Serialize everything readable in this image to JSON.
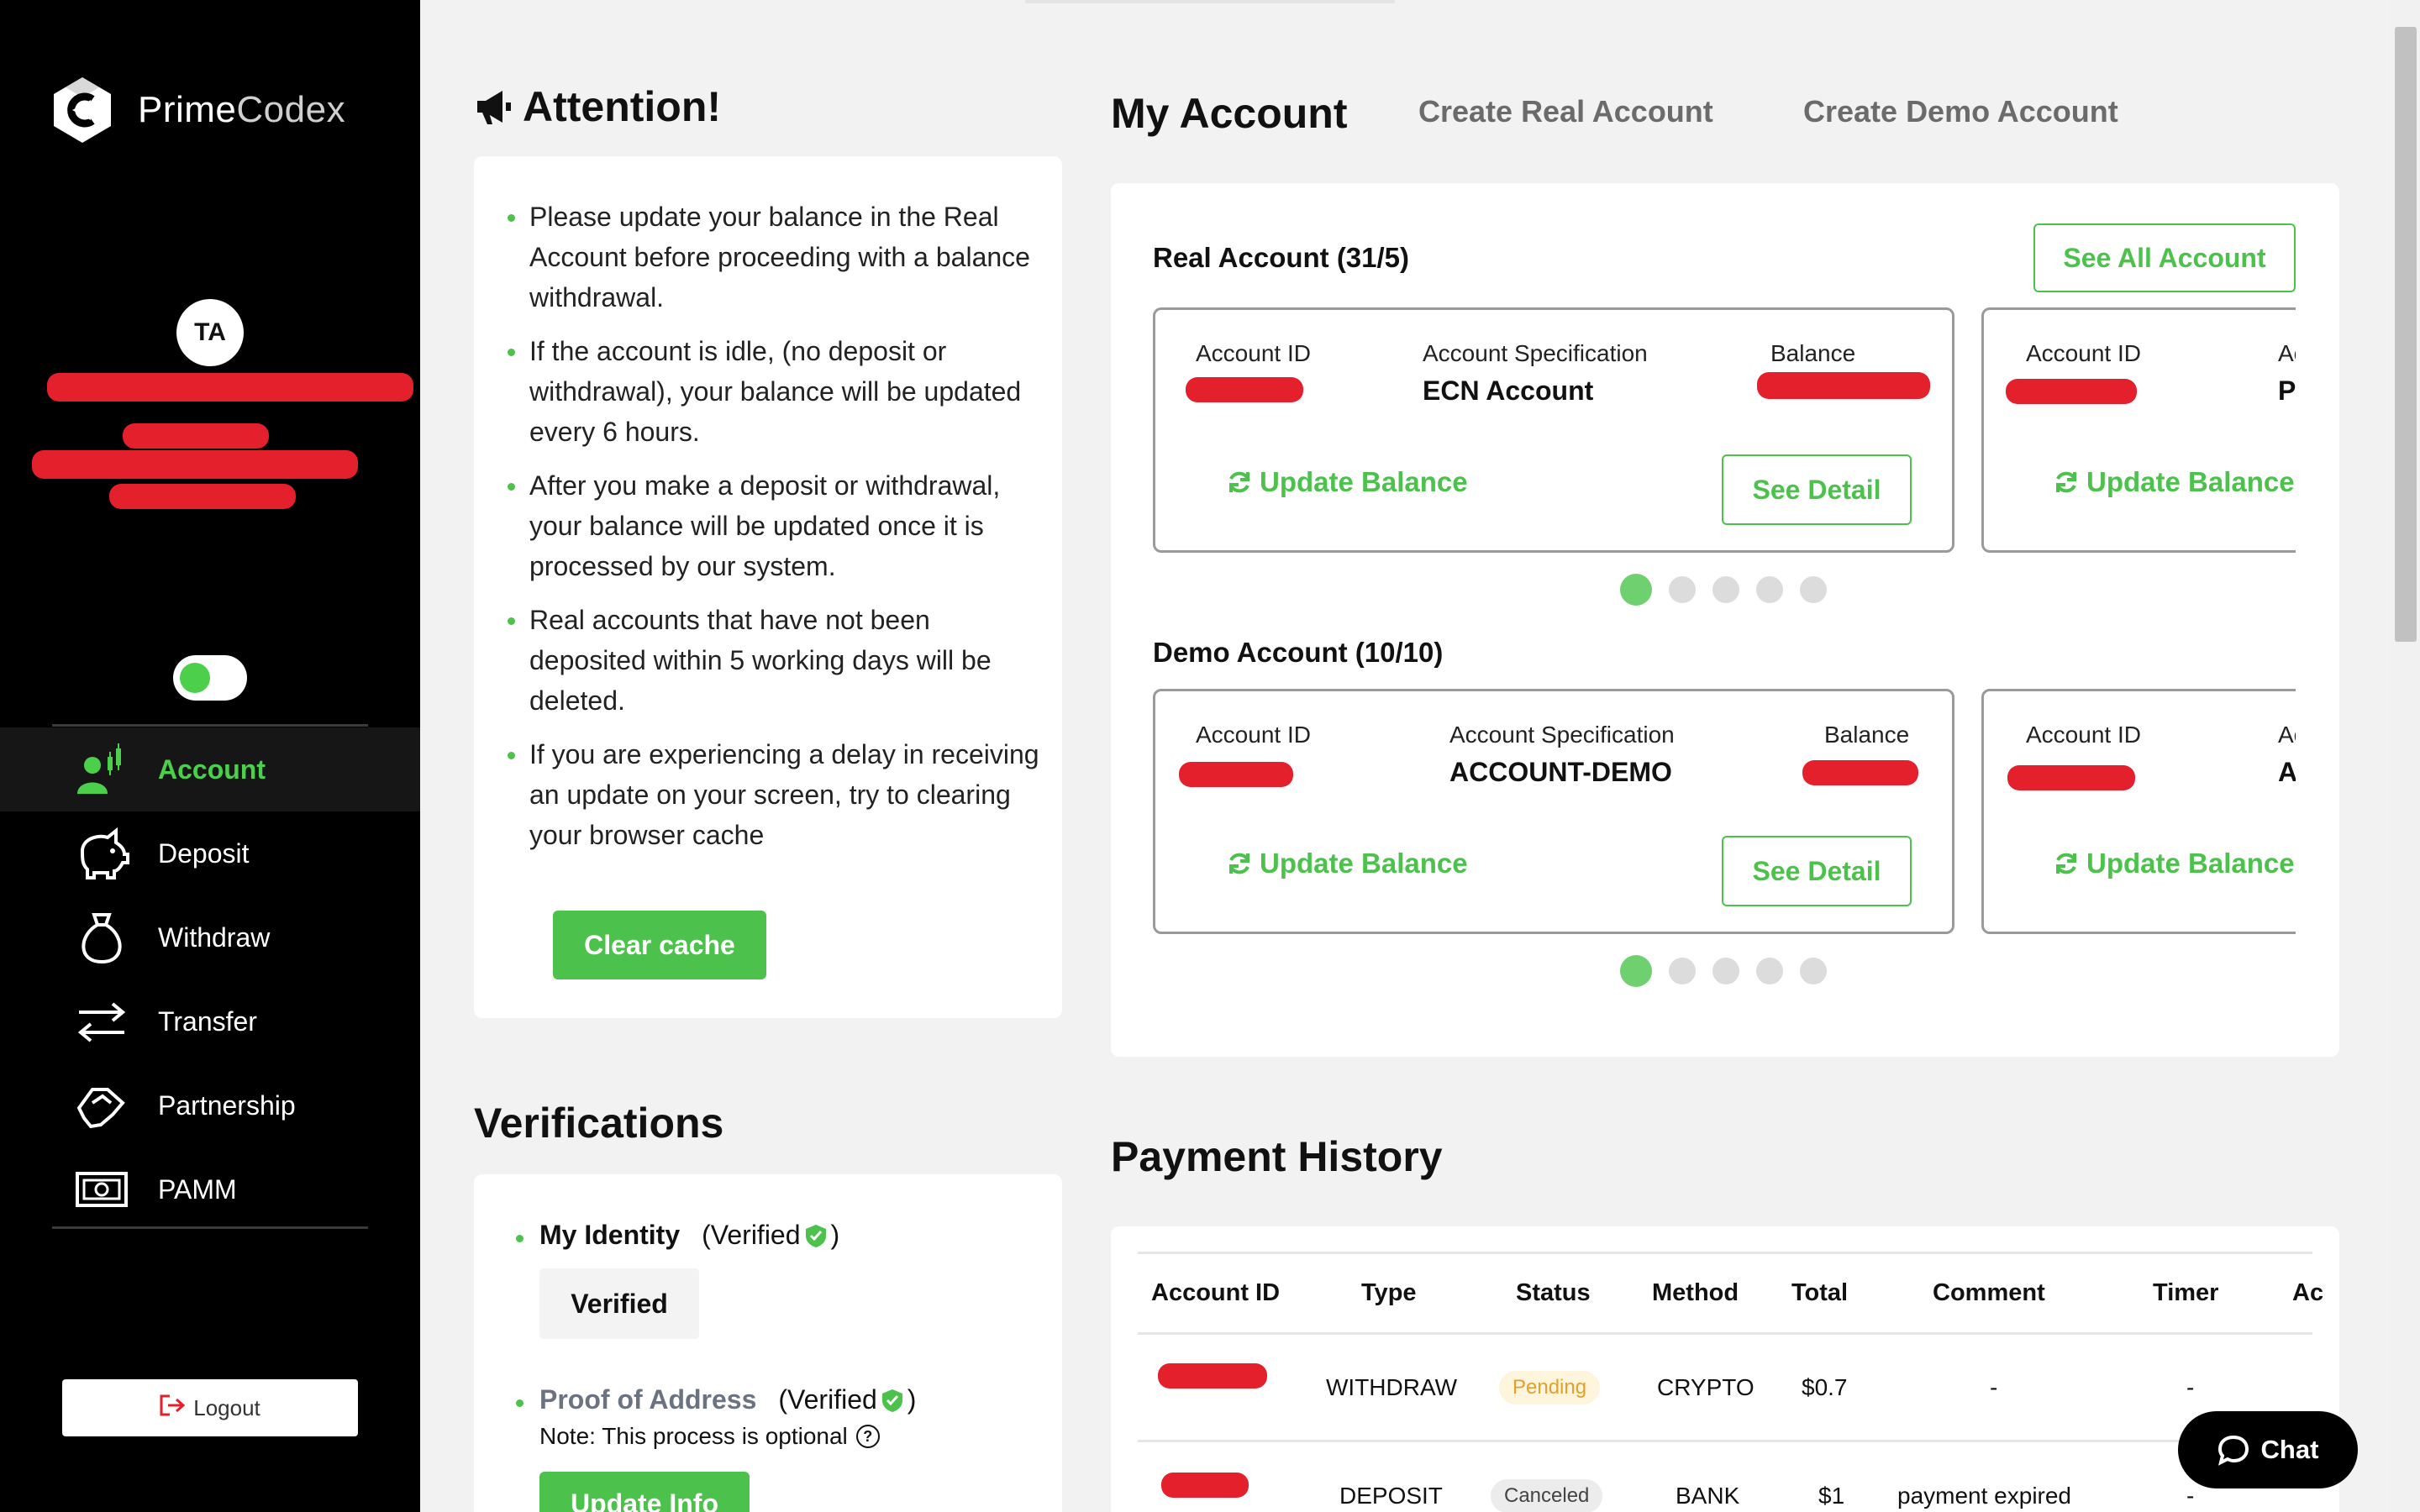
{
  "brand": {
    "name_part1": "Prime",
    "name_part2": "Codex"
  },
  "user": {
    "initials": "TA"
  },
  "sidebar": {
    "items": [
      {
        "label": "Account",
        "icon": "account-chart-icon",
        "active": true
      },
      {
        "label": "Deposit",
        "icon": "piggy-bank-icon"
      },
      {
        "label": "Withdraw",
        "icon": "money-bag-icon"
      },
      {
        "label": "Transfer",
        "icon": "transfer-arrows-icon"
      },
      {
        "label": "Partnership",
        "icon": "handshake-icon"
      },
      {
        "label": "PAMM",
        "icon": "banknote-icon"
      }
    ],
    "logout_label": "Logout"
  },
  "attention": {
    "title": "Attention!",
    "items": [
      "Please update your balance in the Real Account before proceeding with a balance withdrawal.",
      "If the account is idle, (no deposit or withdrawal), your balance will be updated every 6 hours.",
      "After you make a deposit or withdrawal, your balance will be updated once it is processed by our system.",
      "Real accounts that have not been deposited within 5 working days will be deleted.",
      "If you are experiencing a delay in receiving an update on your screen, try to clearing your browser cache"
    ],
    "clear_cache_label": "Clear cache"
  },
  "verifications": {
    "title": "Verifications",
    "identity": {
      "name": "My Identity",
      "status_open": "(Verified",
      "status_close": ")",
      "badge": "Verified"
    },
    "address": {
      "name": "Proof of Address",
      "status_open": "(Verified",
      "status_close": ")",
      "note": "Note: This process is optional"
    },
    "update_info_label": "Update Info"
  },
  "tabs": {
    "my_account": "My Account",
    "create_real": "Create Real Account",
    "create_demo": "Create Demo Account"
  },
  "real": {
    "title": "Real Account (31/5)",
    "see_all_label": "See All Account",
    "labels": {
      "id": "Account ID",
      "spec": "Account Specification",
      "balance": "Balance"
    },
    "spec_value": "ECN Account",
    "next_spec_partial": "P/",
    "next_spec_label_partial": "Ac",
    "update_label": "Update Balance",
    "detail_label": "See Detail",
    "dots": 5,
    "active_dot": 0
  },
  "demo": {
    "title": "Demo Account (10/10)",
    "labels": {
      "id": "Account ID",
      "spec": "Account Specification",
      "balance": "Balance"
    },
    "spec_value": "ACCOUNT-DEMO",
    "next_spec_partial": "A",
    "next_spec_label_partial": "Ac",
    "update_label": "Update Balance",
    "detail_label": "See Detail",
    "dots": 5,
    "active_dot": 0
  },
  "payment": {
    "title": "Payment History",
    "headers": {
      "account_id": "Account ID",
      "type": "Type",
      "status": "Status",
      "method": "Method",
      "total": "Total",
      "comment": "Comment",
      "timer": "Timer",
      "action_partial": "Ac"
    },
    "rows": [
      {
        "type": "WITHDRAW",
        "status": "Pending",
        "method": "CRYPTO",
        "total": "$0.7",
        "comment": "-",
        "timer": "-"
      },
      {
        "type": "DEPOSIT",
        "status": "Canceled",
        "method": "BANK",
        "total": "$1",
        "comment": "payment expired",
        "timer": "-"
      }
    ]
  },
  "chat": {
    "label": "Chat"
  },
  "colors": {
    "accent": "#4cc24c",
    "sidebar_bg": "#000000",
    "redaction": "#e3202c",
    "pending": "#e0a12c"
  }
}
